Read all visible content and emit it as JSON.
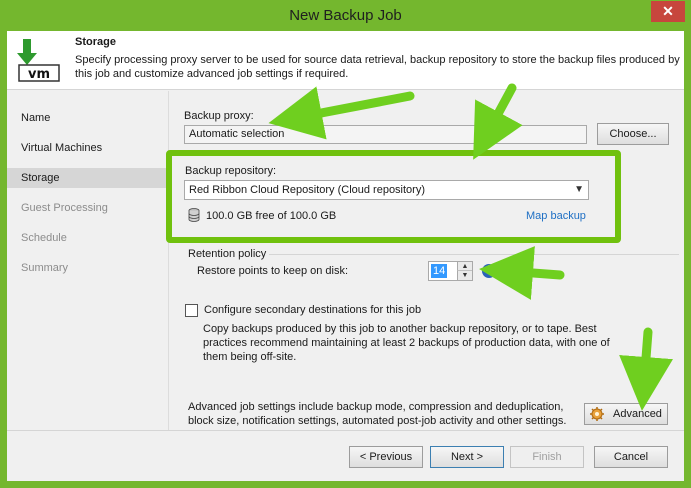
{
  "window": {
    "title": "New Backup Job",
    "close_glyph": "✕"
  },
  "header": {
    "title": "Storage",
    "description": "Specify processing proxy server to be used for source data retrieval, backup repository to store the backup files produced by this job and customize advanced job settings if required.",
    "icon": "storage-vm-icon",
    "icon_text": "vm"
  },
  "nav": {
    "items": [
      {
        "label": "Name"
      },
      {
        "label": "Virtual Machines"
      },
      {
        "label": "Storage"
      },
      {
        "label": "Guest Processing"
      },
      {
        "label": "Schedule"
      },
      {
        "label": "Summary"
      }
    ]
  },
  "proxy": {
    "label": "Backup proxy:",
    "value": "Automatic selection",
    "choose_label": "Choose..."
  },
  "repository": {
    "label": "Backup repository:",
    "value": "Red Ribbon Cloud Repository (Cloud repository)",
    "free_space": "100.0 GB free of 100.0 GB",
    "map_label": "Map backup"
  },
  "retention": {
    "group_label": "Retention policy",
    "restore_label": "Restore points to keep on disk:",
    "restore_value": "14"
  },
  "secondary": {
    "checkbox_label": "Configure secondary destinations for this job",
    "description": "Copy backups produced by this job to another backup repository, or to tape. Best practices recommend maintaining at least 2 backups of production data, with one of them being off-site."
  },
  "advanced": {
    "description": "Advanced job settings include backup mode, compression and deduplication, block size, notification settings, automated post-job activity and other settings.",
    "button_label": "Advanced"
  },
  "footer": {
    "previous_label": "< Previous",
    "next_label": "Next >",
    "finish_label": "Finish",
    "cancel_label": "Cancel"
  },
  "colors": {
    "chrome": "#74b72e",
    "highlight": "#70c10e",
    "link": "#1e6fc4",
    "close": "#c7463d"
  }
}
